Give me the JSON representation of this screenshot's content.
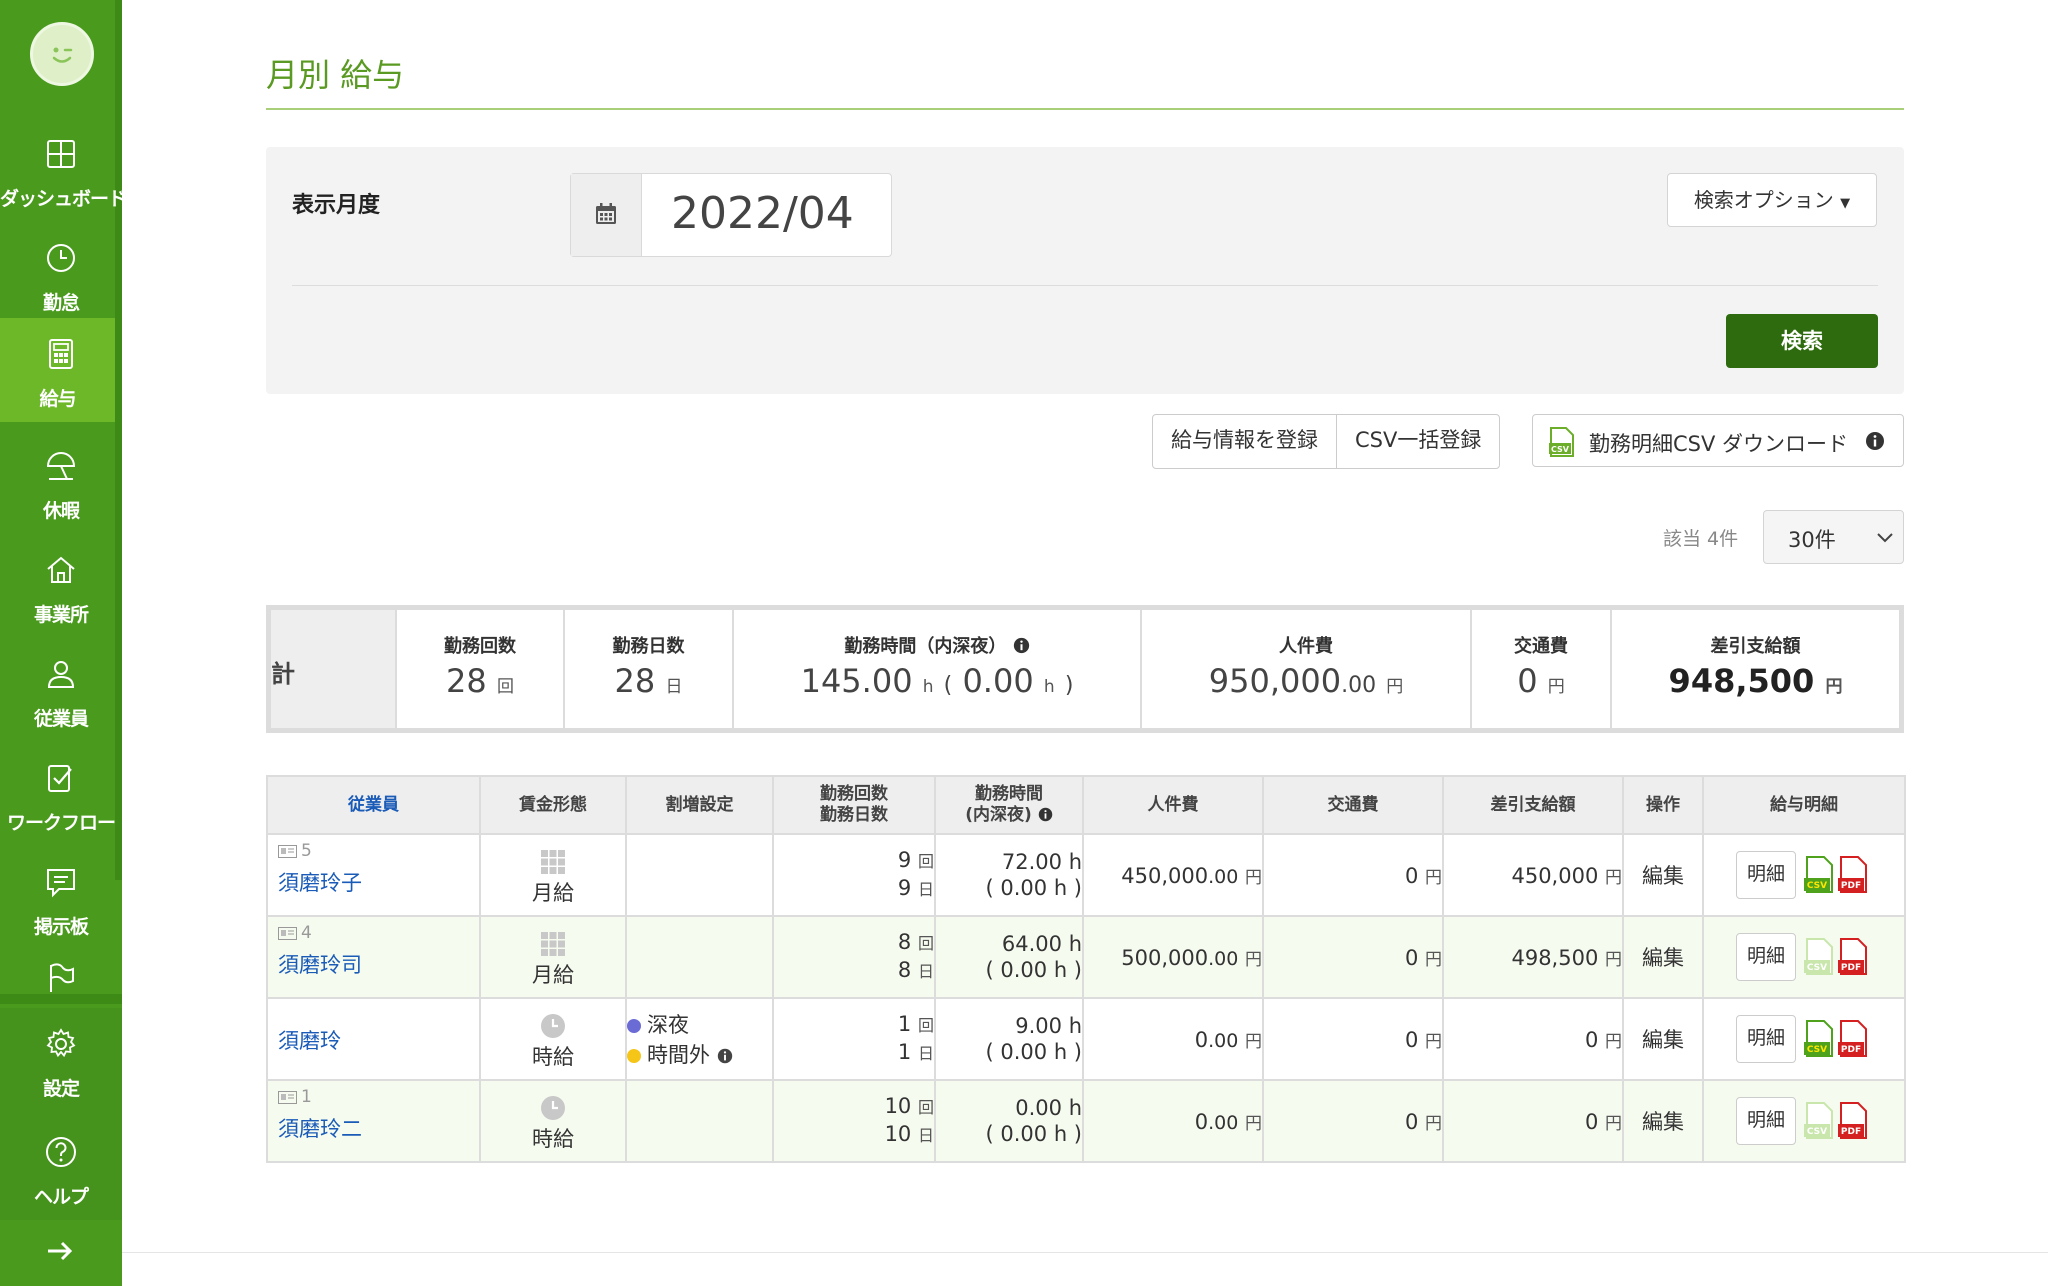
{
  "sidebar": {
    "items": [
      {
        "label": "ダッシュボード",
        "icon": "dashboard-icon"
      },
      {
        "label": "勤怠",
        "icon": "clock-icon"
      },
      {
        "label": "給与",
        "icon": "calculator-icon",
        "active": true
      },
      {
        "label": "休暇",
        "icon": "beach-umbrella-icon"
      },
      {
        "label": "事業所",
        "icon": "home-icon"
      },
      {
        "label": "従業員",
        "icon": "person-icon"
      },
      {
        "label": "ワークフロー",
        "icon": "checklist-icon"
      },
      {
        "label": "掲示板",
        "icon": "chat-icon"
      },
      {
        "label": "",
        "icon": "flag-icon"
      },
      {
        "label": "設定",
        "icon": "gear-icon"
      },
      {
        "label": "ヘルプ",
        "icon": "help-icon"
      }
    ]
  },
  "page": {
    "title": "月別 給与"
  },
  "search": {
    "month_label": "表示月度",
    "month_value": "2022/04",
    "options_label": "検索オプション",
    "search_label": "検索"
  },
  "actions": {
    "register": "給与情報を登録",
    "csv_bulk": "CSV一括登録",
    "csv_download": "勤務明細CSV ダウンロード"
  },
  "pagination": {
    "count_text": "該当 4件",
    "per_page": "30件"
  },
  "summary": {
    "head": "計",
    "columns": [
      {
        "label": "勤務回数",
        "value": "28",
        "unit": "回"
      },
      {
        "label": "勤務日数",
        "value": "28",
        "unit": "日"
      },
      {
        "label": "勤務時間（内深夜）",
        "value": "145.00",
        "unit": "h",
        "value2": "0.00",
        "unit2": "h"
      },
      {
        "label": "人件費",
        "value": "950,000",
        "decimals": ".00",
        "unit": "円"
      },
      {
        "label": "交通費",
        "value": "0",
        "unit": "円"
      },
      {
        "label": "差引支給額",
        "value": "948,500",
        "unit": "円"
      }
    ]
  },
  "table": {
    "headers": {
      "employee": "従業員",
      "wage_type": "賃金形態",
      "premium": "割増設定",
      "count_a": "勤務回数",
      "count_b": "勤務日数",
      "time_a": "勤務時間",
      "time_b": "(内深夜)",
      "labor": "人件費",
      "transport": "交通費",
      "net": "差引支給額",
      "ops": "操作",
      "payslip": "給与明細"
    },
    "units": {
      "count": "回",
      "days": "日",
      "hour": "h",
      "yen": "円"
    },
    "edit_label": "編集",
    "detail_label": "明細",
    "premium_night": "深夜",
    "premium_overtime": "時間外",
    "rows": [
      {
        "id": "5",
        "name": "須磨玲子",
        "wage": "月給",
        "count": "9",
        "days": "9",
        "hours": "72.00",
        "night": "( 0.00 h )",
        "labor": "450,000",
        "labor_dec": ".00",
        "transport": "0",
        "net": "450,000"
      },
      {
        "id": "4",
        "name": "須磨玲司",
        "wage": "月給",
        "count": "8",
        "days": "8",
        "hours": "64.00",
        "night": "( 0.00 h )",
        "labor": "500,000",
        "labor_dec": ".00",
        "transport": "0",
        "net": "498,500"
      },
      {
        "id": "",
        "name": "須磨玲",
        "wage": "時給",
        "count": "1",
        "days": "1",
        "hours": "9.00",
        "night": "( 0.00 h )",
        "labor": "0",
        "labor_dec": ".00",
        "transport": "0",
        "net": "0"
      },
      {
        "id": "1",
        "name": "須磨玲二",
        "wage": "時給",
        "count": "10",
        "days": "10",
        "hours": "0.00",
        "night": "( 0.00 h )",
        "labor": "0",
        "labor_dec": ".00",
        "transport": "0",
        "net": "0"
      }
    ]
  },
  "colors": {
    "sidebar": "#4a9a1e",
    "sidebar_active": "#6cb828",
    "accent": "#5a9a22",
    "search_button": "#2e6b0e",
    "link": "#1a5bb8"
  }
}
